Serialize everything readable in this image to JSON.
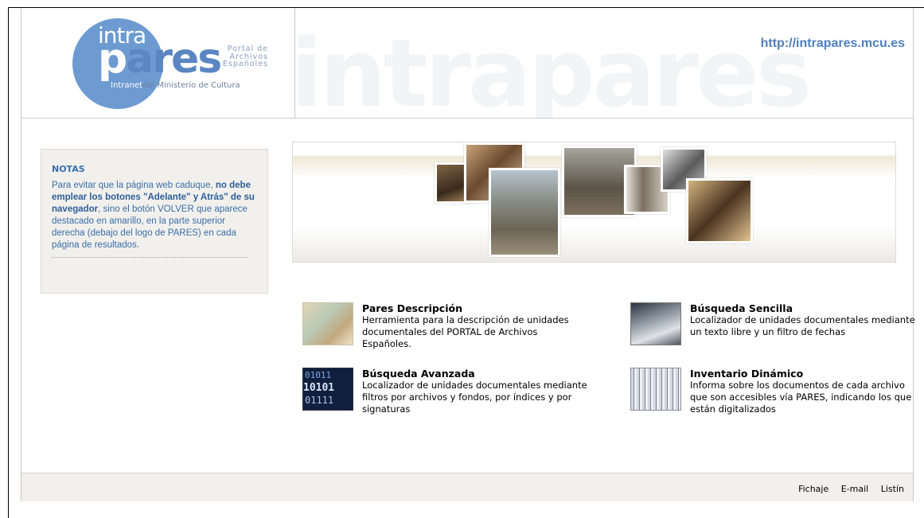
{
  "header": {
    "logo": {
      "intra": "intra",
      "pares_p": "p",
      "pares_rest": "ares",
      "portal_line1": "Portal de",
      "portal_line2": "Archivos",
      "portal_line3": "Españoles",
      "intranet": "Intranet",
      "ministry": "del Ministerio de Cultura"
    },
    "watermark": "intrapares",
    "url": "http://intrapares.mcu.es"
  },
  "notes": {
    "title": "NOTAS",
    "text_1": "Para evitar que la página web caduque, ",
    "text_bold": "no debe emplear los botones \"Adelante\" y Atrás\" de su navegador",
    "text_2": ", sino el botón VOLVER que aparece destacado en amarillo, en la parte superior derecha (debajo del logo de PARES) en cada página de resultados."
  },
  "cards": [
    {
      "title": "Pares Descripción",
      "desc": "Herramienta para la descripción de unidades documentales del PORTAL de Archivos Españoles.",
      "icon": "documents-thumbnail"
    },
    {
      "title": "Búsqueda Sencilla",
      "desc": "Localizador de unidades documentales mediante un texto libre y un filtro de fechas",
      "icon": "keyboard-thumbnail"
    },
    {
      "title": "Búsqueda Avanzada",
      "desc": "Localizador de unidades documentales mediante filtros por archivos y fondos, por índices y por signaturas",
      "icon": "binary-thumbnail"
    },
    {
      "title": "Inventario Dinámico",
      "desc": "Informa sobre los documentos de cada archivo que son accesibles vía PARES, indicando los que están digitalizados",
      "icon": "shelves-thumbnail"
    }
  ],
  "footer": {
    "links": [
      "Fichaje",
      "E-mail",
      "Listín"
    ]
  },
  "colors": {
    "brand_blue": "#6d9bd1",
    "link_blue": "#4f7fbf",
    "notes_bg": "#f1f0ec"
  }
}
